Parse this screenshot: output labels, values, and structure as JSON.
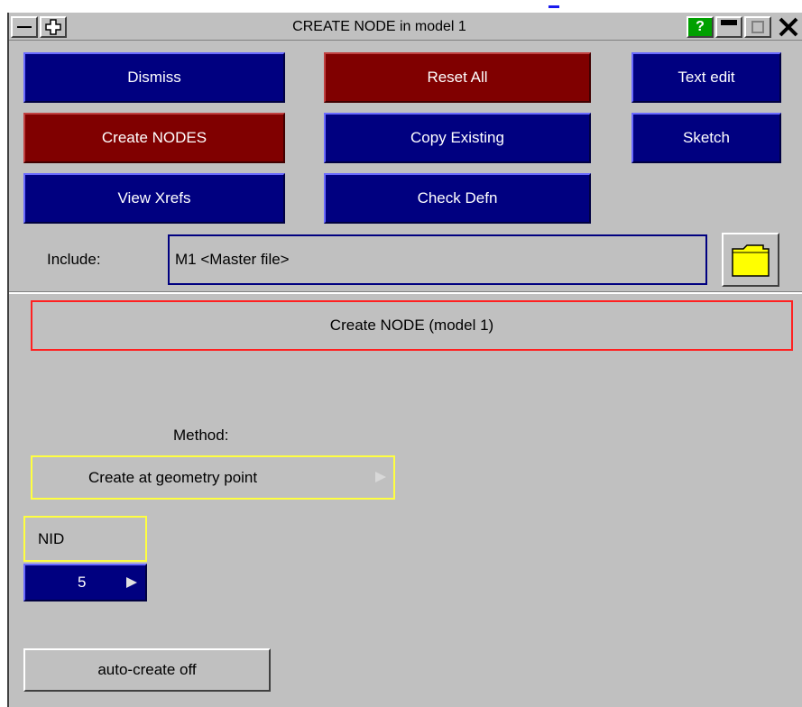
{
  "window": {
    "title": "CREATE NODE in model 1",
    "help_label": "?"
  },
  "buttons": {
    "dismiss": "Dismiss",
    "reset_all": "Reset All",
    "text_edit": "Text edit",
    "create_nodes": "Create NODES",
    "copy_existing": "Copy Existing",
    "sketch": "Sketch",
    "view_xrefs": "View Xrefs",
    "check_defn": "Check Defn"
  },
  "include": {
    "label": "Include:",
    "value": "M1  <Master file>"
  },
  "panel": {
    "title": "Create NODE (model 1)"
  },
  "method": {
    "label": "Method:",
    "selected": "Create at geometry point"
  },
  "nid": {
    "label": "NID",
    "value": "5"
  },
  "auto_create": {
    "label": "auto-create off"
  },
  "colors": {
    "panel_bg": "#c0c0c0",
    "button_blue": "#000080",
    "button_red": "#800000",
    "highlight_yellow": "#ffff40",
    "panel_border_red": "#ff2020"
  }
}
